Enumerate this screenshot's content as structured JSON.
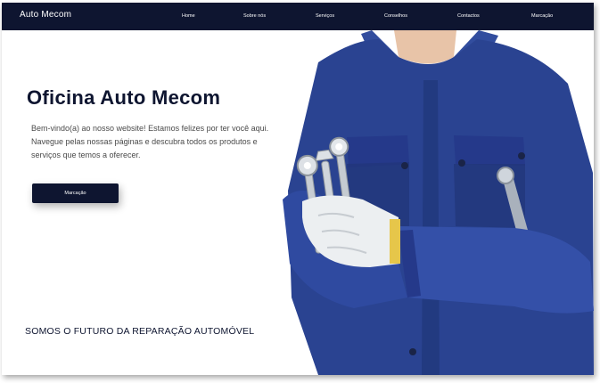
{
  "header": {
    "brand": "Auto Mecom",
    "nav": [
      "Home",
      "Sobre nós",
      "Serviços",
      "Conselhos",
      "Contactos",
      "Marcação"
    ]
  },
  "hero": {
    "title": "Oficina Auto Mecom",
    "description": "Bem-vindo(a) ao nosso website! Estamos felizes por ter você aqui. Navegue pelas nossas páginas e descubra todos os produtos e serviços que temos a oferecer.",
    "cta_label": "Marcação",
    "image_subject": "mechanic-with-wrenches"
  },
  "tagline": "SOMOS O FUTURO DA REPARAÇÃO AUTOMÓVEL",
  "colors": {
    "navy": "#0e1530",
    "uniform_blue": "#2a4391",
    "background": "#ffffff",
    "body_text": "#4a4a4a"
  }
}
